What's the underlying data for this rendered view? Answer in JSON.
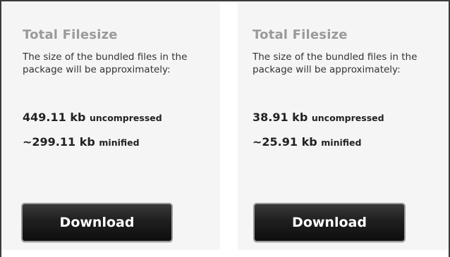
{
  "panels": [
    {
      "title": "Total Filesize",
      "description": "The size of the bundled files in the package will be approximately:",
      "uncompressed_value": "449.11 kb",
      "uncompressed_unit": "uncompressed",
      "minified_value": "~299.11 kb",
      "minified_unit": "minified",
      "download_label": "Download"
    },
    {
      "title": "Total Filesize",
      "description": "The size of the bundled files in the package will be approximately:",
      "uncompressed_value": "38.91 kb",
      "uncompressed_unit": "uncompressed",
      "minified_value": "~25.91 kb",
      "minified_unit": "minified",
      "download_label": "Download"
    }
  ],
  "colors": {
    "panel_bg": "#f5f5f5",
    "title": "#9a9a9a",
    "button_bg": "#1f1f1f",
    "button_border": "#9a9a9a"
  }
}
